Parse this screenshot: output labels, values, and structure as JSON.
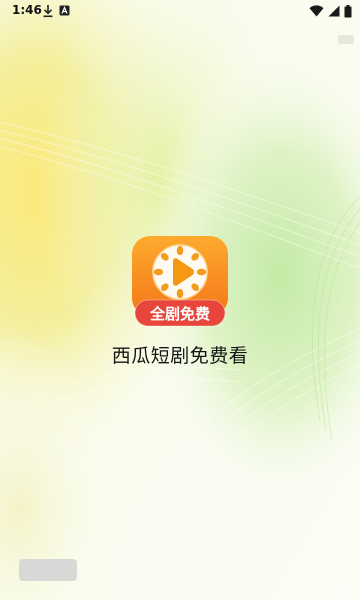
{
  "status_bar": {
    "time": "1:46",
    "icons": [
      "download-icon",
      "a-notification-icon",
      "wifi-icon",
      "signal-icon",
      "battery-icon"
    ]
  },
  "splash": {
    "app_name": "西瓜短剧免费看",
    "badge_label": "全剧免费",
    "logo_icon": "play-icon"
  },
  "colors": {
    "logo_orange": "#fb8c1b",
    "badge_red": "#e9443c",
    "play_orange": "#f49b12",
    "bg_yellow": "#f2ef92",
    "bg_green": "#bde8a6"
  }
}
